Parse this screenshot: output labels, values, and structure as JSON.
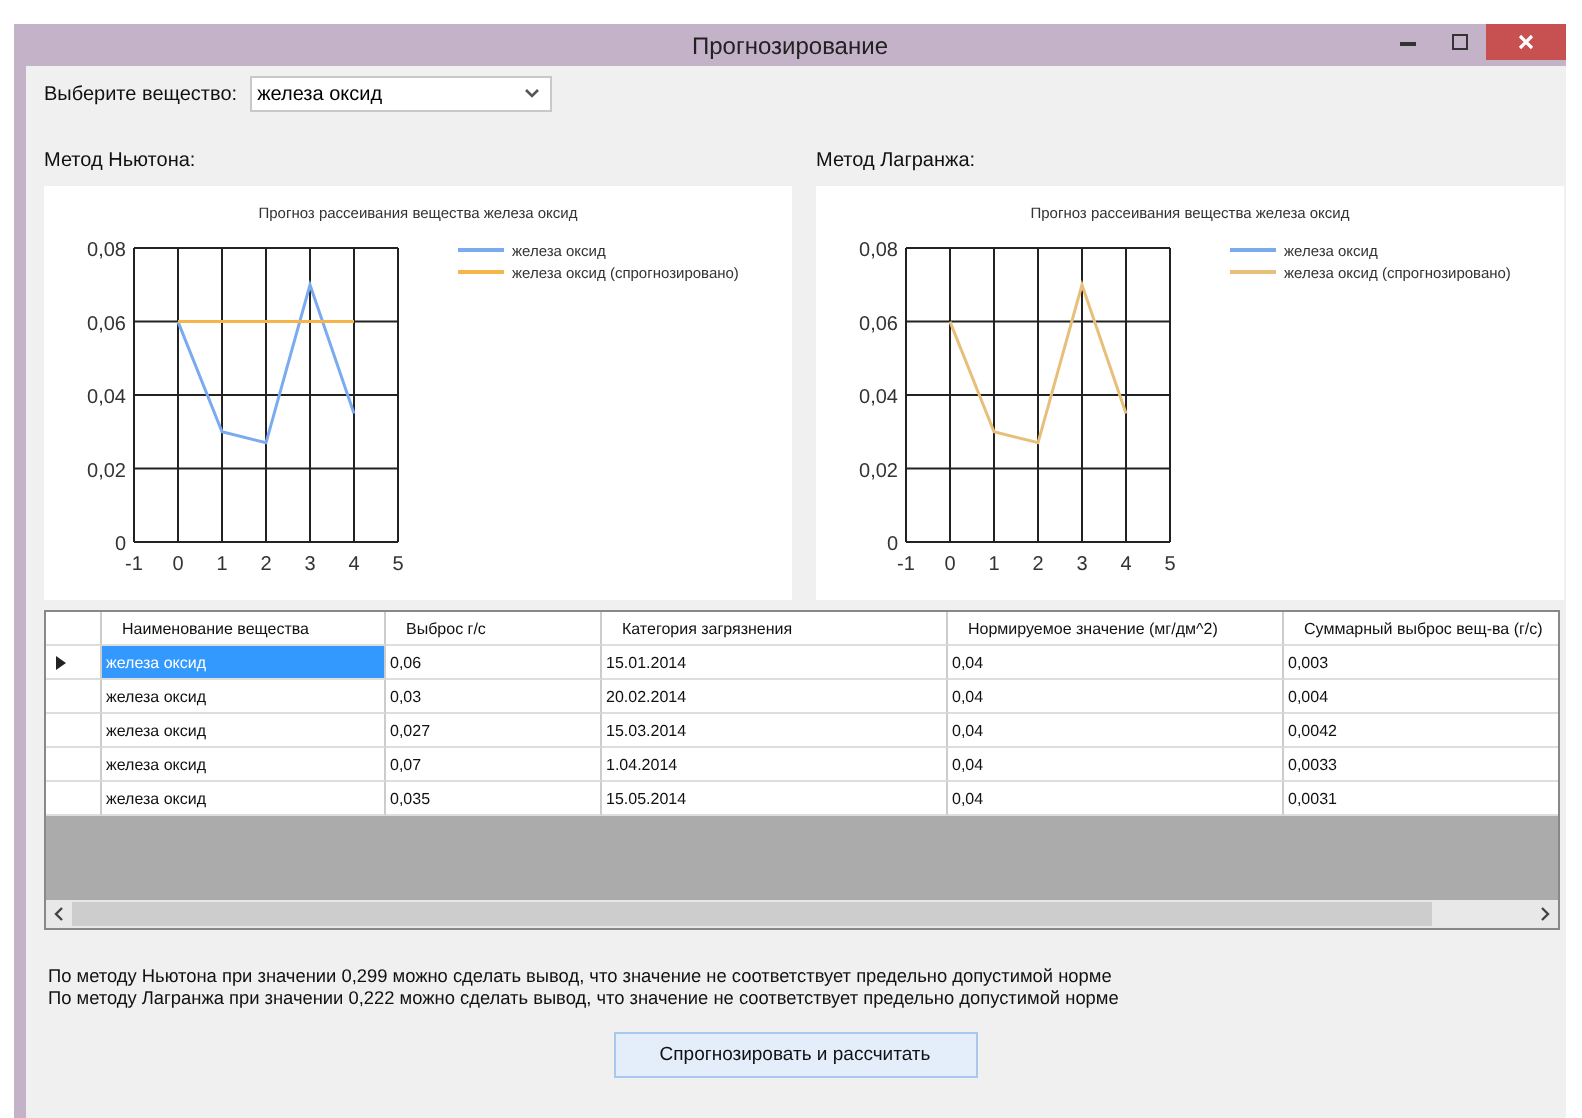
{
  "window": {
    "title": "Прогнозирование"
  },
  "substance_picker": {
    "label": "Выберите вещество:",
    "value": "железа оксид"
  },
  "methods": [
    {
      "label": "Метод Ньютона:",
      "chart_data": {
        "type": "line",
        "grid": true,
        "legend": "right",
        "title": "Прогноз рассеивания вещества железа оксид",
        "x": [
          0,
          1,
          2,
          3,
          4
        ],
        "xlim": [
          -1,
          5
        ],
        "ylim": [
          0,
          0.08
        ],
        "xticks": [
          -1,
          0,
          1,
          2,
          3,
          4,
          5
        ],
        "yticks": [
          {
            "value": 0,
            "label": "0"
          },
          {
            "value": 0.02,
            "label": "0,02"
          },
          {
            "value": 0.04,
            "label": "0,04"
          },
          {
            "value": 0.06,
            "label": "0,06"
          },
          {
            "value": 0.08,
            "label": "0,08"
          }
        ],
        "series": [
          {
            "name": "железа оксид",
            "color": "#7aaaf0",
            "values": [
              0.06,
              0.03,
              0.027,
              0.07,
              0.035
            ]
          },
          {
            "name": "железа оксид (спрогнозировано)",
            "color": "#f5b54a",
            "values": [
              0.06,
              0.06,
              0.06,
              0.06,
              0.06
            ]
          }
        ]
      }
    },
    {
      "label": "Метод Лагранжа:",
      "chart_data": {
        "type": "line",
        "grid": true,
        "legend": "right",
        "title": "Прогноз рассеивания вещества железа оксид",
        "x": [
          0,
          1,
          2,
          3,
          4
        ],
        "xlim": [
          -1,
          5
        ],
        "ylim": [
          0,
          0.08
        ],
        "xticks": [
          -1,
          0,
          1,
          2,
          3,
          4,
          5
        ],
        "yticks": [
          {
            "value": 0,
            "label": "0"
          },
          {
            "value": 0.02,
            "label": "0,02"
          },
          {
            "value": 0.04,
            "label": "0,04"
          },
          {
            "value": 0.06,
            "label": "0,06"
          },
          {
            "value": 0.08,
            "label": "0,08"
          }
        ],
        "series": [
          {
            "name": "железа оксид",
            "color": "#7aaaf0",
            "values": [
              null,
              null,
              null,
              null,
              null
            ]
          },
          {
            "name": "железа оксид (спрогнозировано)",
            "color": "#e8bf7a",
            "values": [
              0.06,
              0.03,
              0.027,
              0.07,
              0.035
            ]
          }
        ]
      }
    }
  ],
  "table": {
    "columns": [
      "Наименование вещества",
      "Выброс г/с",
      "Категория загрязнения",
      "Нормируемое значение (мг/дм^2)",
      "Суммарный выброс вещ-ва (г/с)"
    ],
    "rows": [
      {
        "selected": true,
        "cells": [
          "железа оксид",
          "0,06",
          "15.01.2014",
          "0,04",
          "0,003"
        ]
      },
      {
        "selected": false,
        "cells": [
          "железа оксид",
          "0,03",
          "20.02.2014",
          "0,04",
          "0,004"
        ]
      },
      {
        "selected": false,
        "cells": [
          "железа оксид",
          "0,027",
          "15.03.2014",
          "0,04",
          "0,0042"
        ]
      },
      {
        "selected": false,
        "cells": [
          "железа оксид",
          "0,07",
          "1.04.2014",
          "0,04",
          "0,0033"
        ]
      },
      {
        "selected": false,
        "cells": [
          "железа оксид",
          "0,035",
          "15.05.2014",
          "0,04",
          "0,0031"
        ]
      }
    ]
  },
  "conclusions": [
    "По методу Ньютона при значении 0,299 можно сделать вывод, что значение не соответствует предельно допустимой норме",
    "По методу Лагранжа при значении 0,222 можно сделать вывод, что значение не соответствует предельно допустимой норме"
  ],
  "action_button": "Спрогнозировать и рассчитать"
}
